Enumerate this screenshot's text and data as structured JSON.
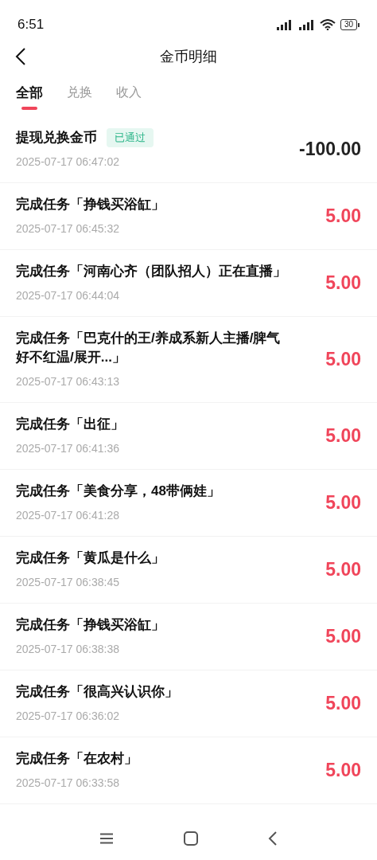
{
  "status_bar": {
    "time": "6:51",
    "battery": "30"
  },
  "header": {
    "title": "金币明细"
  },
  "tabs": [
    {
      "label": "全部",
      "selected": true
    },
    {
      "label": "兑换",
      "selected": false
    },
    {
      "label": "收入",
      "selected": false
    }
  ],
  "records": [
    {
      "kind": "expense",
      "title": "提现兑换金币",
      "badge": "已通过",
      "time": "2025-07-17 06:47:02",
      "amount": "-100.00"
    },
    {
      "kind": "income",
      "title": "完成任务「挣钱买浴缸」",
      "time": "2025-07-17 06:45:32",
      "amount": "5.00"
    },
    {
      "kind": "income",
      "title": "完成任务「河南心齐（团队招人）正在直播」",
      "time": "2025-07-17 06:44:04",
      "amount": "5.00"
    },
    {
      "kind": "income",
      "title": "完成任务「巴克什的王/养成系新人主播/脾气好不红温/展开...」",
      "time": "2025-07-17 06:43:13",
      "amount": "5.00"
    },
    {
      "kind": "income",
      "title": "完成任务「出征」",
      "time": "2025-07-17 06:41:36",
      "amount": "5.00"
    },
    {
      "kind": "income",
      "title": "完成任务「美食分享，48带俩娃」",
      "time": "2025-07-17 06:41:28",
      "amount": "5.00"
    },
    {
      "kind": "income",
      "title": "完成任务「黄瓜是什么」",
      "time": "2025-07-17 06:38:45",
      "amount": "5.00"
    },
    {
      "kind": "income",
      "title": "完成任务「挣钱买浴缸」",
      "time": "2025-07-17 06:38:38",
      "amount": "5.00"
    },
    {
      "kind": "income",
      "title": "完成任务「很高兴认识你」",
      "time": "2025-07-17 06:36:02",
      "amount": "5.00"
    },
    {
      "kind": "income",
      "title": "完成任务「在农村」",
      "time": "2025-07-17 06:33:58",
      "amount": "5.00"
    }
  ]
}
